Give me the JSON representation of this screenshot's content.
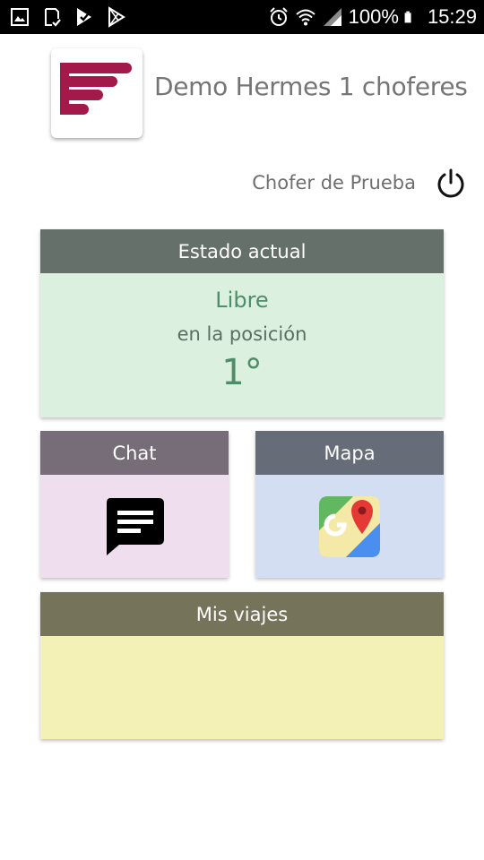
{
  "status_bar": {
    "battery": "100%",
    "time": "15:29",
    "left_icons": [
      "image-icon",
      "clipboard-check-icon",
      "play-store-check-icon",
      "play-store-icon"
    ],
    "right_icons": [
      "alarm-icon",
      "wifi-icon",
      "signal-icon",
      "battery-icon"
    ]
  },
  "header": {
    "logo": "hermes-logo-icon",
    "title": "Demo Hermes 1 choferes",
    "driver_name": "Chofer de Prueba",
    "logout_icon": "power-icon"
  },
  "estado": {
    "title": "Estado actual",
    "status": "Libre",
    "position_label": "en la posición",
    "position": "1°"
  },
  "chat": {
    "title": "Chat",
    "icon": "chat-bubble-icon"
  },
  "mapa": {
    "title": "Mapa",
    "icon": "google-maps-icon"
  },
  "viajes": {
    "title": "Mis viajes"
  },
  "colors": {
    "logo_red": "#a31a4a",
    "estado_header": "#66706b",
    "estado_body": "#dcf0e0",
    "estado_text": "#4f8d6a",
    "chat_header": "#776d78",
    "chat_body": "#eedeee",
    "mapa_header": "#666c78",
    "mapa_body": "#d4def2",
    "viajes_header": "#76735b",
    "viajes_body": "#f4f1b6"
  }
}
